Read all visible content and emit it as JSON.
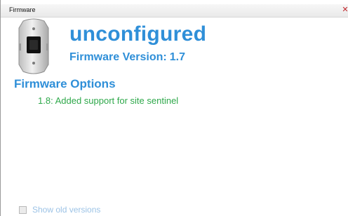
{
  "window": {
    "title": "Firmware",
    "close_icon": "close-icon"
  },
  "device": {
    "icon": "device-icon",
    "name": "unconfigured",
    "firmware_label": "Firmware Version:",
    "firmware_version": "1.7"
  },
  "options": {
    "heading": "Firmware Options",
    "items": [
      {
        "label": "1.8: Added support for site sentinel"
      }
    ]
  },
  "show_old_versions": {
    "label": "Show old versions",
    "checked": false
  },
  "colors": {
    "heading_blue": "#2f8fd8",
    "option_green": "#2ea84a",
    "disabled_blue": "#9cc3e6"
  }
}
